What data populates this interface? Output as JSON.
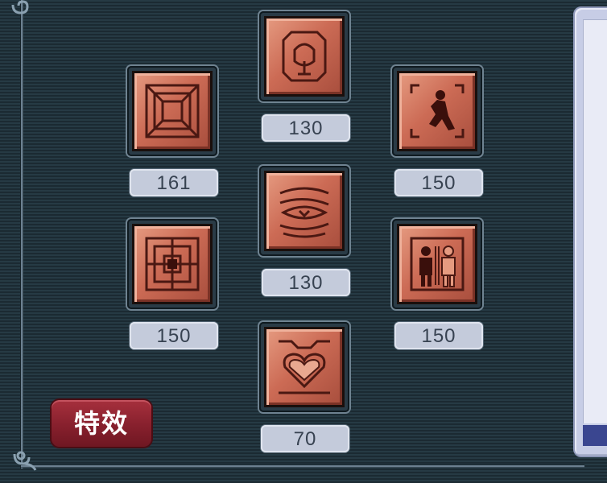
{
  "slots": [
    {
      "icon": "concentric-square-icon",
      "value": "161"
    },
    {
      "icon": "helmet-icon",
      "value": "130"
    },
    {
      "icon": "figure-icon",
      "value": "150"
    },
    {
      "icon": "eye-icon",
      "value": "130"
    },
    {
      "icon": "web-square-icon",
      "value": "150"
    },
    {
      "icon": "twin-figure-icon",
      "value": "150"
    },
    {
      "icon": "heart-icon",
      "value": "70"
    }
  ],
  "effect_button": {
    "label": "特效"
  },
  "colors": {
    "tile": "#cc6b55",
    "value_box": "#c4cbdb",
    "button": "#87202d",
    "side_panel": "#c7cde6",
    "accent_bar": "#3a4690"
  }
}
